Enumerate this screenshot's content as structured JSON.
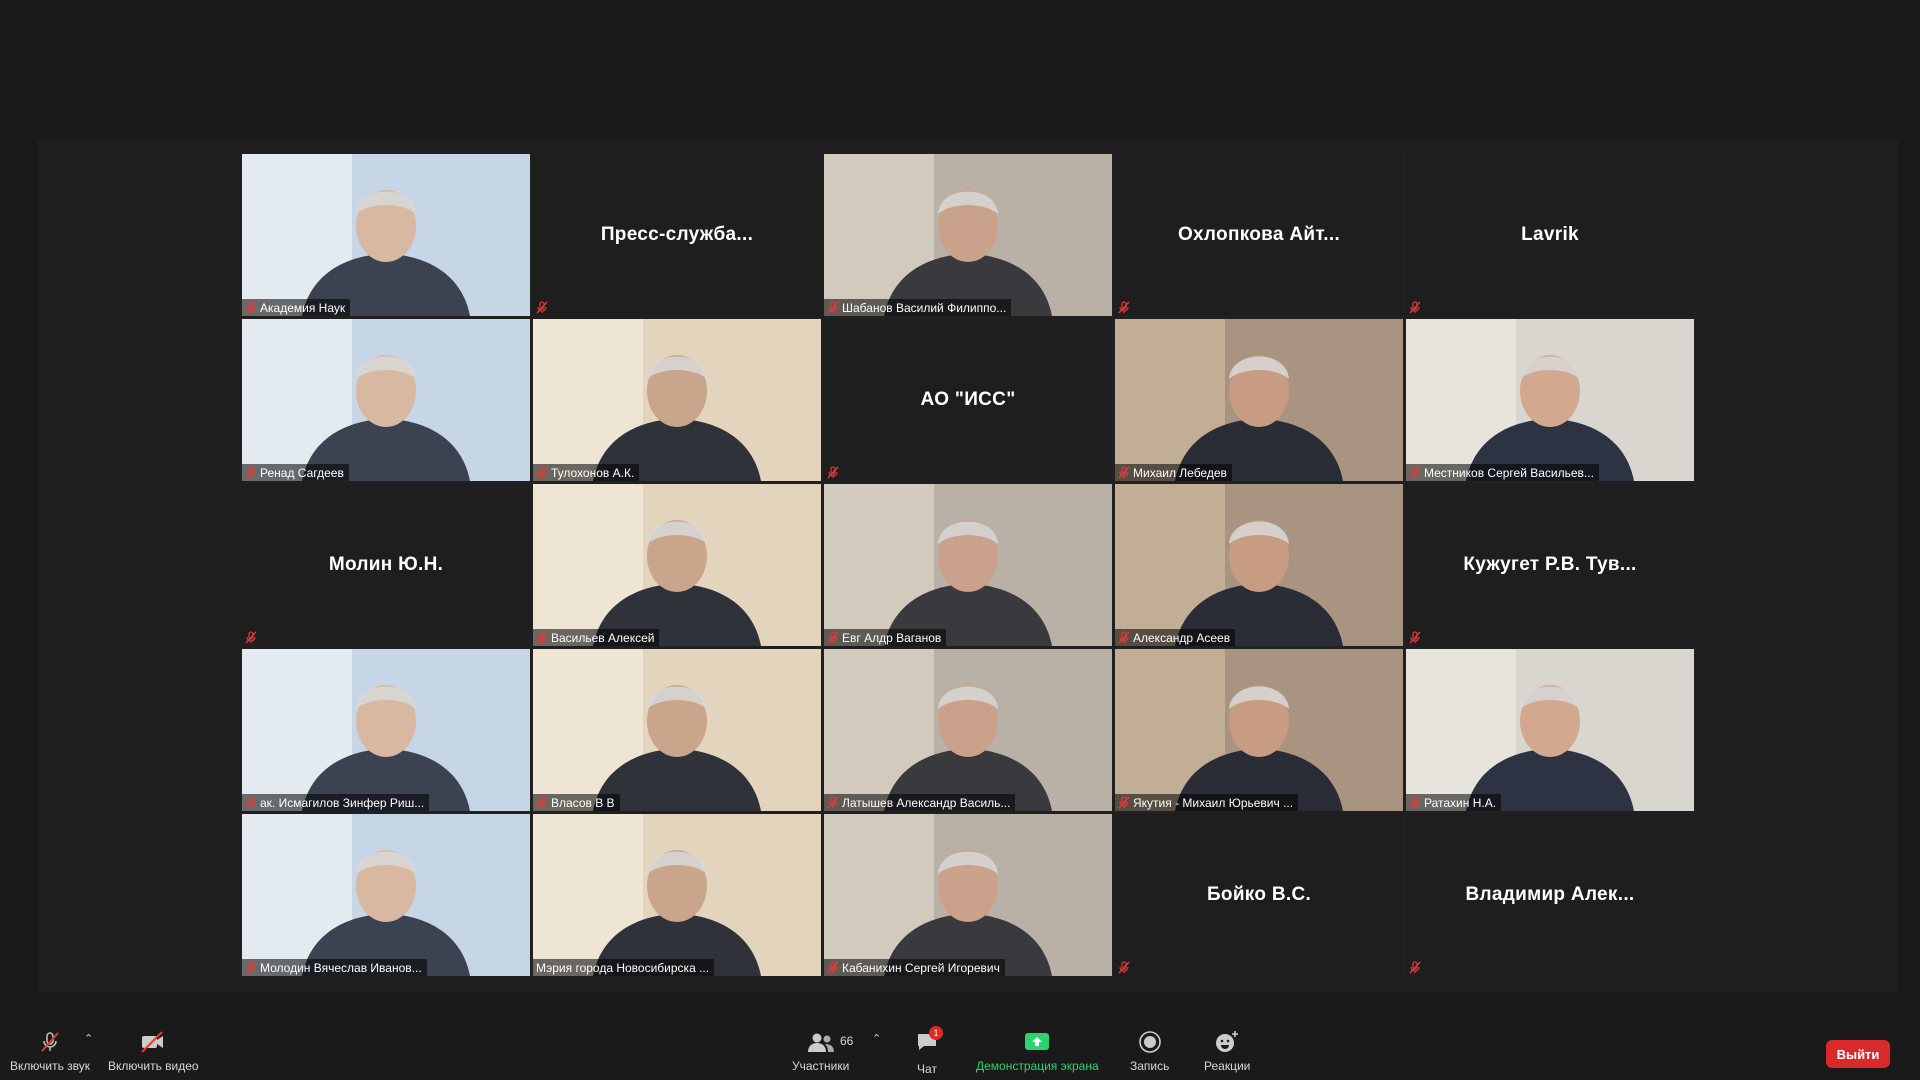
{
  "participants": [
    {
      "name": "Академия Наук",
      "video": true
    },
    {
      "name": "Пресс-служба...",
      "video": false,
      "card": "Пресс-служба..."
    },
    {
      "name": "Шабанов Василий Филиппо...",
      "video": true
    },
    {
      "name": "Охлопкова  Айт...",
      "video": false,
      "card": "Охлопкова  Айт..."
    },
    {
      "name": "Lavrik",
      "video": false,
      "card": "Lavrik"
    },
    {
      "name": "Ренад Сагдеев",
      "video": true
    },
    {
      "name": "Тулохонов А.К.",
      "video": true
    },
    {
      "name": "АО \"ИСС\"",
      "video": false,
      "card": "АО \"ИСС\""
    },
    {
      "name": "Михаил Лебедев",
      "video": true
    },
    {
      "name": "Местников Сергей Васильев...",
      "video": true
    },
    {
      "name": "Молин Ю.Н.",
      "video": false,
      "card": "Молин Ю.Н."
    },
    {
      "name": "Васильев Алексей",
      "video": true
    },
    {
      "name": "Евг Алдр Ваганов",
      "video": true
    },
    {
      "name": "Александр Асеев",
      "video": true
    },
    {
      "name": "Кужугет Р.В. Тув...",
      "video": false,
      "card": "Кужугет Р.В. Тув..."
    },
    {
      "name": "ак. Исмагилов Зинфер Риш...",
      "video": true
    },
    {
      "name": "Власов В В",
      "video": true
    },
    {
      "name": "Латышев Александр Василь...",
      "video": true
    },
    {
      "name": "Якутия - Михаил Юрьевич ...",
      "video": true
    },
    {
      "name": "Ратахин Н.А.",
      "video": true
    },
    {
      "name": "Молодин Вячеслав Иванов...",
      "video": true
    },
    {
      "name": "Мэрия города Новосибирска ...",
      "video": true,
      "no_mic": true
    },
    {
      "name": "Кабанихин Сергей Игоревич",
      "video": true
    },
    {
      "name": "Бойко В.С.",
      "video": false,
      "card": "Бойко В.С."
    },
    {
      "name": "Владимир  Алек...",
      "video": false,
      "card": "Владимир  Алек..."
    }
  ],
  "toolbar": {
    "unmute": "Включить звук",
    "start_video": "Включить видео",
    "participants": "Участники",
    "participants_count": "66",
    "chat": "Чат",
    "chat_badge": "1",
    "share": "Демонстрация экрана",
    "record": "Запись",
    "reactions": "Реакции",
    "leave": "Выйти"
  },
  "colors": {
    "accent_green": "#2dd36f",
    "leave_red": "#d82a2a",
    "mute_red": "#e03a3a"
  }
}
